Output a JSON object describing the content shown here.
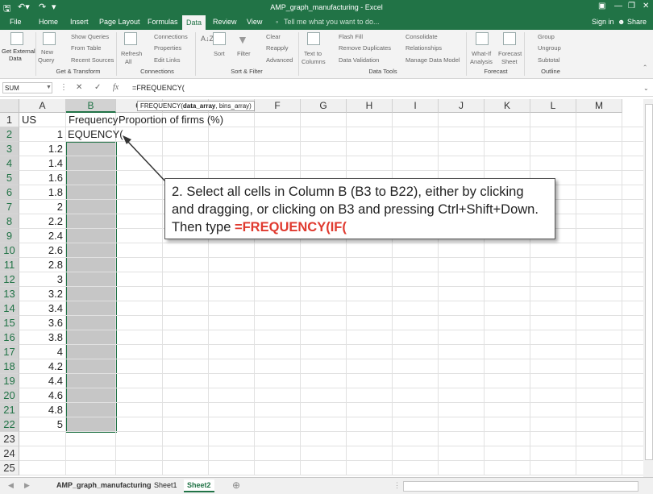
{
  "window": {
    "title": "AMP_graph_manufacturing - Excel",
    "account": "Sign in",
    "share": "Share"
  },
  "tabs": [
    "File",
    "Home",
    "Insert",
    "Page Layout",
    "Formulas",
    "Data",
    "Review",
    "View"
  ],
  "tell_me": "Tell me what you want to do...",
  "ribbon": {
    "get_external": [
      "Get External",
      "Data"
    ],
    "new_query": [
      "New",
      "Query"
    ],
    "show_queries": "Show Queries",
    "from_table": "From Table",
    "recent_sources": "Recent Sources",
    "refresh": [
      "Refresh",
      "All"
    ],
    "connections": "Connections",
    "properties": "Properties",
    "edit_links": "Edit Links",
    "sort": "Sort",
    "filter": "Filter",
    "clear": "Clear",
    "reapply": "Reapply",
    "advanced": "Advanced",
    "text_to_columns": [
      "Text to",
      "Columns"
    ],
    "flash_fill": "Flash Fill",
    "remove_duplicates": "Remove Duplicates",
    "data_validation": "Data Validation",
    "consolidate": "Consolidate",
    "relationships": "Relationships",
    "manage_data_model": "Manage Data Model",
    "what_if": [
      "What-If",
      "Analysis"
    ],
    "forecast_sheet": [
      "Forecast",
      "Sheet"
    ],
    "group": "Group",
    "ungroup": "Ungroup",
    "subtotal": "Subtotal",
    "groups": [
      "Get & Transform",
      "Connections",
      "Sort & Filter",
      "Data Tools",
      "Forecast",
      "Outline"
    ]
  },
  "formula_bar": {
    "name_box": "SUM",
    "formula": "=FREQUENCY(",
    "tooltip_prefix": "FREQUENCY(",
    "tooltip_bold": "data_array",
    "tooltip_rest": ", bins_array)"
  },
  "columns": [
    "A",
    "B",
    "C",
    "D",
    "E",
    "F",
    "G",
    "H",
    "I",
    "J",
    "K",
    "L",
    "M"
  ],
  "rows": [
    "1",
    "2",
    "3",
    "4",
    "5",
    "6",
    "7",
    "8",
    "9",
    "10",
    "11",
    "12",
    "13",
    "14",
    "15",
    "16",
    "17",
    "18",
    "19",
    "20",
    "21",
    "22",
    "23",
    "24",
    "25"
  ],
  "cells": {
    "A1": "US",
    "B1": "Frequency",
    "C1": "Proportion of firms (%)",
    "B2": "EQUENCY(",
    "A_values": [
      "1",
      "1.2",
      "1.4",
      "1.6",
      "1.8",
      "2",
      "2.2",
      "2.4",
      "2.6",
      "2.8",
      "3",
      "3.2",
      "3.4",
      "3.6",
      "3.8",
      "4",
      "4.2",
      "4.4",
      "4.6",
      "4.8",
      "5"
    ]
  },
  "callout": {
    "line1": "2. Select all cells in Column B (B3 to B22), either by clicking",
    "line2": "and dragging, or clicking on B3 and pressing Ctrl+Shift+Down.",
    "line3_prefix": "Then type ",
    "line3_code": "=FREQUENCY(IF("
  },
  "sheets": [
    "AMP_graph_manufacturing",
    "Sheet1",
    "Sheet2"
  ],
  "active_sheet": "Sheet2",
  "colors": {
    "excel_green": "#217346",
    "selection_gray": "#c6c6c6",
    "code_red": "#e03a2f"
  }
}
